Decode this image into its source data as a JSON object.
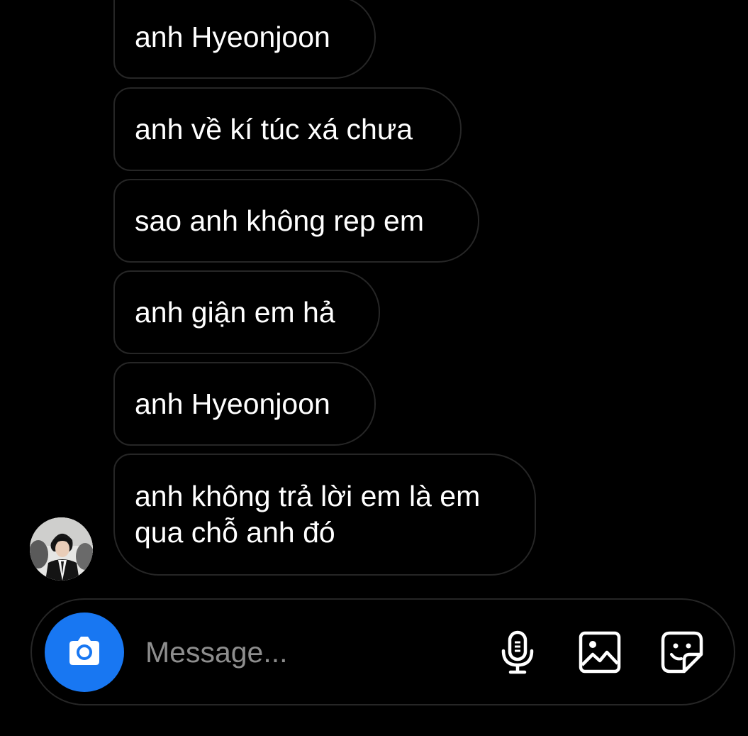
{
  "thread": {
    "messages": [
      {
        "text": "anh Hyeonjoon"
      },
      {
        "text": "anh về kí túc xá chưa"
      },
      {
        "text": "sao anh không rep em"
      },
      {
        "text": "anh giận em hả"
      },
      {
        "text": "anh Hyeonjoon"
      },
      {
        "text": "anh không trả lời em là em qua chỗ anh đó"
      }
    ],
    "sender_avatar": "profile-photo-man-in-black-suit"
  },
  "composer": {
    "placeholder": "Message...",
    "icons": {
      "camera": "camera-icon",
      "microphone": "microphone-icon",
      "gallery": "image-icon",
      "sticker": "sticker-icon"
    }
  },
  "colors": {
    "background": "#000000",
    "bubble_border": "#262626",
    "text": "#ffffff",
    "placeholder": "#8e8e8e",
    "accent": "#1877f2"
  }
}
